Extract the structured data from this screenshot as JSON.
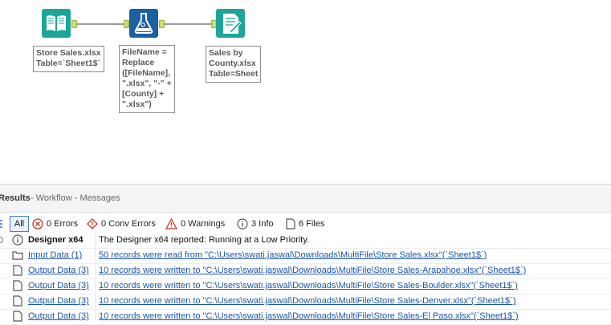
{
  "canvas": {
    "tools": [
      {
        "name": "input-data-tool",
        "icon": "book-icon",
        "color": "#1ea59a"
      },
      {
        "name": "formula-tool",
        "icon": "flask-icon",
        "color": "#1c5fa3"
      },
      {
        "name": "output-data-tool",
        "icon": "document-icon",
        "color": "#1ea59a"
      }
    ],
    "annotations": {
      "input": "Store Sales.xlsx\nTable=`Sheet1$`",
      "formula": "FileName =\nReplace\n([FileName],\n\".xlsx\", \"-\" +\n[County] +\n\".xlsx\")",
      "output": "Sales by\nCounty.xlsx\nTable=Sheet"
    }
  },
  "results": {
    "title": "Results",
    "subtitle": "- Workflow - Messages",
    "filters": {
      "all": "All",
      "errors": "0 Errors",
      "conv_errors": "0 Conv Errors",
      "warnings": "0 Warnings",
      "info": "3 Info",
      "files": "6 Files"
    },
    "rows": [
      {
        "tool": "Designer x64",
        "message": "The Designer x64 reported: Running at a Low Priority.",
        "icon": "info-icon"
      },
      {
        "tool": "Input Data (1)",
        "message": "50 records were read from \"C:\\Users\\swati.jaswal\\Downloads\\MultiFile\\Store Sales.xlsx\"(`Sheet1$`)",
        "icon": "folder-icon"
      },
      {
        "tool": "Output Data (3)",
        "message": "10 records were written to \"C:\\Users\\swati.jaswal\\Downloads\\MultiFile\\Store Sales-Arapahoe.xlsx\"(`Sheet1$`)",
        "icon": "file-icon"
      },
      {
        "tool": "Output Data (3)",
        "message": "10 records were written to \"C:\\Users\\swati.jaswal\\Downloads\\MultiFile\\Store Sales-Boulder.xlsx\"(`Sheet1$`)",
        "icon": "file-icon"
      },
      {
        "tool": "Output Data (3)",
        "message": "10 records were written to \"C:\\Users\\swati.jaswal\\Downloads\\MultiFile\\Store Sales-Denver.xlsx\"(`Sheet1$`)",
        "icon": "file-icon"
      },
      {
        "tool": "Output Data (3)",
        "message": "10 records were written to \"C:\\Users\\swati.jaswal\\Downloads\\MultiFile\\Store Sales-El Paso.xlsx\"(`Sheet1$`)",
        "icon": "file-icon"
      }
    ]
  }
}
